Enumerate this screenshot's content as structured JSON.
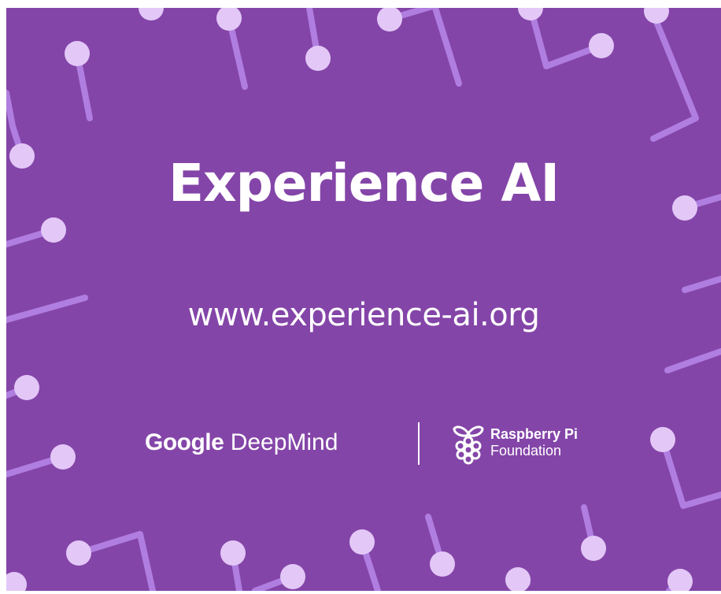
{
  "banner": {
    "title": "Experience AI",
    "url": "www.experience-ai.org",
    "partners": {
      "google_word": "Google",
      "deepmind_word": "DeepMind",
      "rpi_line1": "Raspberry Pi",
      "rpi_line2": "Foundation"
    },
    "colors": {
      "background": "#8445a8",
      "line": "#b07ee0",
      "node": "#e3c8f7",
      "text": "#ffffff"
    },
    "icons": [
      "raspberry-pi-icon"
    ]
  }
}
